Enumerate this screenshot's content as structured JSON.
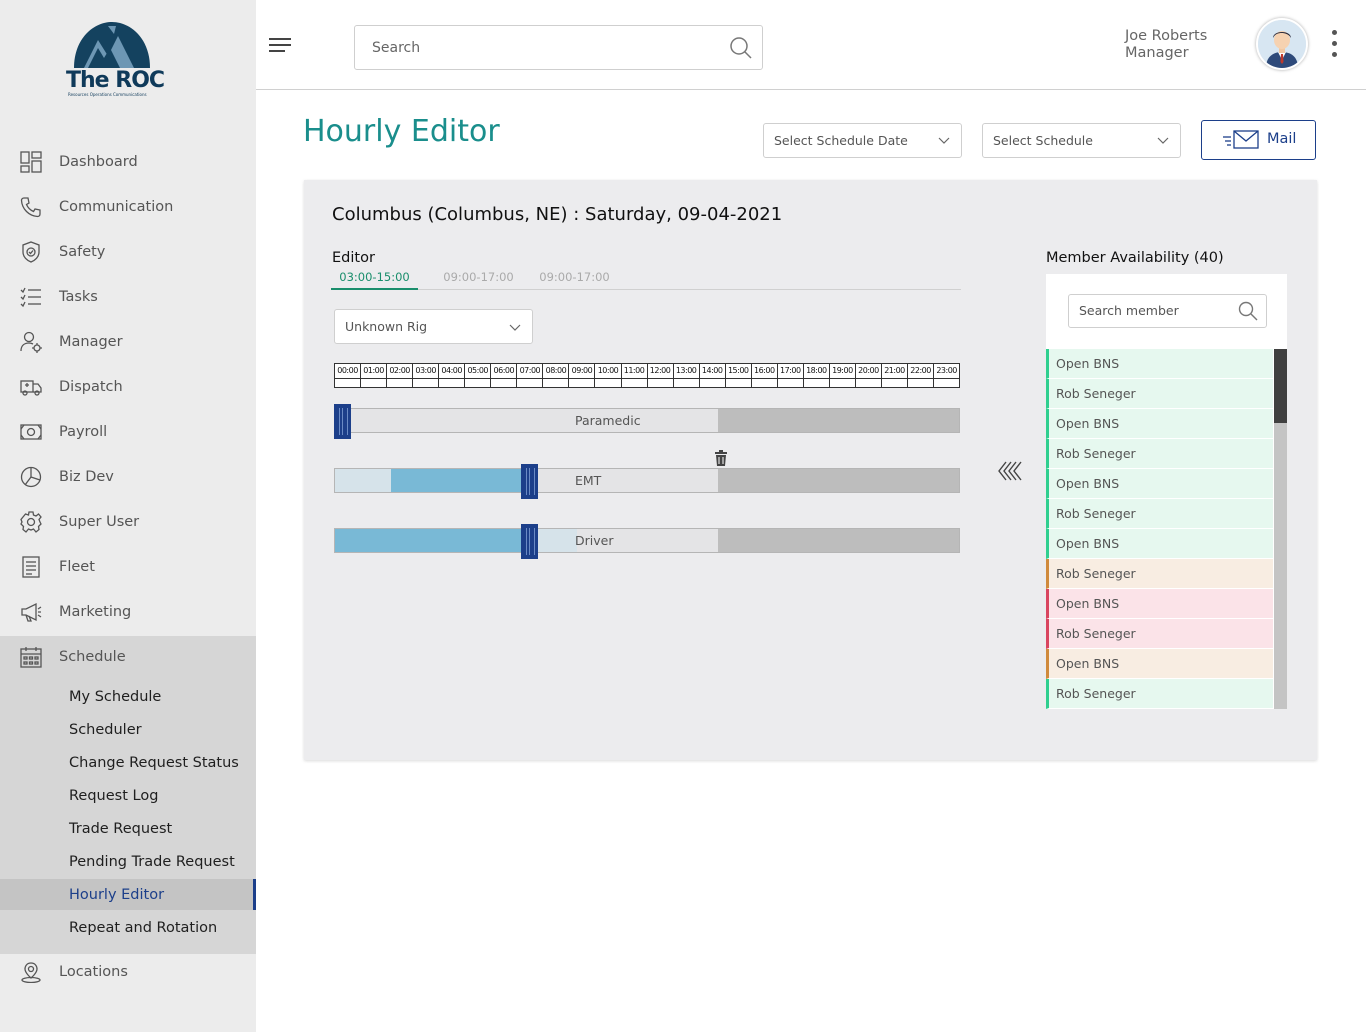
{
  "brand": {
    "name": "The ROC",
    "tagline": "Resources Operations Communications"
  },
  "nav": [
    {
      "label": "Dashboard",
      "icon": "dashboard-icon"
    },
    {
      "label": "Communication",
      "icon": "phone-icon"
    },
    {
      "label": "Safety",
      "icon": "shield-icon"
    },
    {
      "label": "Tasks",
      "icon": "list-icon"
    },
    {
      "label": "Manager",
      "icon": "manager-icon"
    },
    {
      "label": "Dispatch",
      "icon": "truck-icon"
    },
    {
      "label": "Payroll",
      "icon": "payroll-icon"
    },
    {
      "label": "Biz Dev",
      "icon": "pie-chart-icon"
    },
    {
      "label": "Super User",
      "icon": "gear-icon"
    },
    {
      "label": "Fleet",
      "icon": "fleet-icon"
    },
    {
      "label": "Marketing",
      "icon": "megaphone-icon"
    },
    {
      "label": "Schedule",
      "icon": "calendar-icon"
    }
  ],
  "schedule_sub": [
    {
      "label": "My Schedule"
    },
    {
      "label": "Scheduler"
    },
    {
      "label": "Change Request Status"
    },
    {
      "label": "Request Log"
    },
    {
      "label": "Trade Request"
    },
    {
      "label": "Pending Trade Request"
    },
    {
      "label": "Hourly Editor",
      "active": true
    },
    {
      "label": "Repeat and Rotation"
    }
  ],
  "locations": {
    "label": "Locations",
    "icon": "location-pin-icon"
  },
  "search": {
    "placeholder": "Search"
  },
  "user": {
    "name": "Joe Roberts",
    "role": "Manager"
  },
  "page": {
    "title": "Hourly Editor",
    "date_select": "Select Schedule Date",
    "schedule_select": "Select Schedule",
    "mail_label": "Mail"
  },
  "card": {
    "title": "Columbus (Columbus, NE) : Saturday, 09-04-2021",
    "editor_label": "Editor",
    "tabs": [
      "03:00-15:00",
      "09:00-17:00",
      "09:00-17:00"
    ],
    "rig_select": "Unknown Rig",
    "hours": [
      "00:00",
      "01:00",
      "02:00",
      "03:00",
      "04:00",
      "05:00",
      "06:00",
      "07:00",
      "08:00",
      "09:00",
      "10:00",
      "11:00",
      "12:00",
      "13:00",
      "14:00",
      "15:00",
      "16:00",
      "17:00",
      "18:00",
      "19:00",
      "20:00",
      "21:00",
      "22:00",
      "23:00"
    ],
    "tracks": [
      {
        "label": "Paramedic"
      },
      {
        "label": "EMT"
      },
      {
        "label": "Driver"
      }
    ]
  },
  "members": {
    "title": "Member Availability (40)",
    "search_placeholder": "Search member",
    "list": [
      {
        "name": "Open BNS",
        "status": "green"
      },
      {
        "name": "Rob Seneger",
        "status": "green"
      },
      {
        "name": "Open BNS",
        "status": "green"
      },
      {
        "name": "Rob Seneger",
        "status": "green"
      },
      {
        "name": "Open BNS",
        "status": "green"
      },
      {
        "name": "Rob Seneger",
        "status": "green"
      },
      {
        "name": "Open BNS",
        "status": "green"
      },
      {
        "name": "Rob Seneger",
        "status": "orange"
      },
      {
        "name": "Open BNS",
        "status": "red"
      },
      {
        "name": "Rob Seneger",
        "status": "red"
      },
      {
        "name": "Open BNS",
        "status": "orange"
      },
      {
        "name": "Rob Seneger",
        "status": "green"
      }
    ]
  },
  "colors": {
    "accent": "#1a8e8c",
    "primary": "#1c3f8a",
    "bar_blue": "#79b9d6"
  }
}
